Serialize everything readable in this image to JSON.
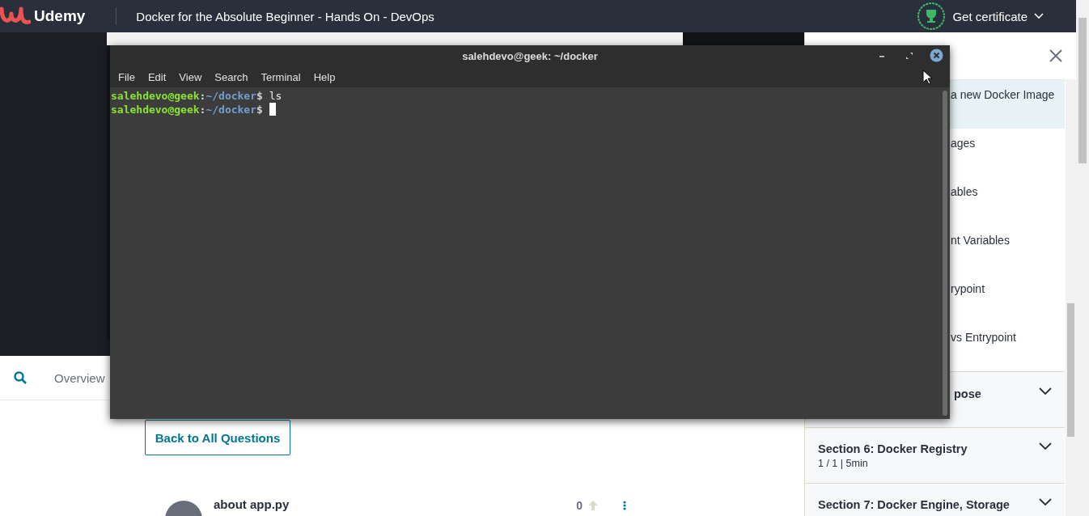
{
  "header": {
    "brand": "Udemy",
    "course_title": "Docker for the Absolute Beginner - Hands On - DevOps",
    "certificate": "Get certificate"
  },
  "tabs": [
    {
      "label": "Overview"
    }
  ],
  "back_button": "Back to All Questions",
  "question": {
    "title": "about app.py",
    "votes": "0"
  },
  "sidebar": {
    "lectures": [
      {
        "title": "a new Docker Image",
        "selected": true
      },
      {
        "title": "ages",
        "selected": false
      },
      {
        "title": "ables",
        "selected": false
      },
      {
        "title": "nt Variables",
        "selected": false
      },
      {
        "title": "rypoint",
        "selected": false
      },
      {
        "title": "vs Entrypoint",
        "selected": false
      }
    ],
    "sections": [
      {
        "title": "pose"
      },
      {
        "title": "Section 6: Docker Registry",
        "meta": "1 / 1 | 5min"
      },
      {
        "title": "Section 7: Docker Engine, Storage"
      }
    ]
  },
  "terminal": {
    "title": "salehdevo@geek: ~/docker",
    "menu": [
      "File",
      "Edit",
      "View",
      "Search",
      "Terminal",
      "Help"
    ],
    "lines": [
      {
        "user": "salehdevo@geek",
        "separator": ":",
        "path": "~/docker",
        "prompt": "$",
        "command": "ls",
        "cursor": false
      },
      {
        "user": "salehdevo@geek",
        "separator": ":",
        "path": "~/docker",
        "prompt": "$",
        "cursor": true
      }
    ]
  }
}
